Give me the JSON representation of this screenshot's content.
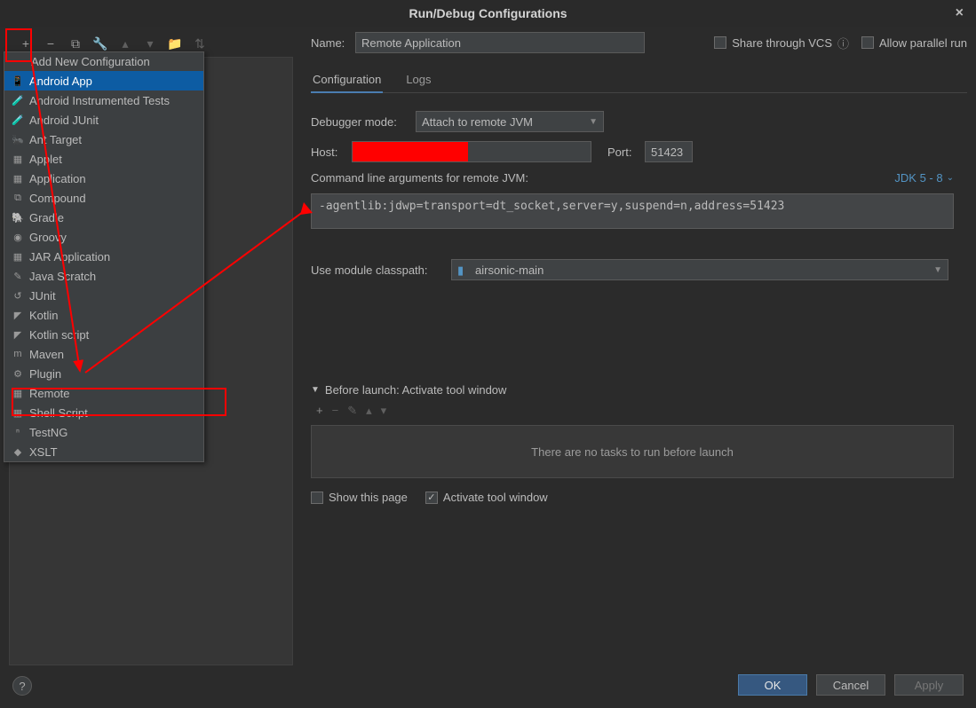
{
  "window": {
    "title": "Run/Debug Configurations"
  },
  "toolbar": {
    "add_hint": "+",
    "remove_hint": "−",
    "copy_hint": "⧉",
    "wrench_hint": "🔧",
    "up_hint": "▴",
    "down_hint": "▾",
    "folder_hint": "📁",
    "sort_hint": "⇅"
  },
  "dropdown": {
    "header": "Add New Configuration",
    "items": [
      {
        "label": "Android App",
        "icon": "📱",
        "selected": true
      },
      {
        "label": "Android Instrumented Tests",
        "icon": "🧪"
      },
      {
        "label": "Android JUnit",
        "icon": "🧪"
      },
      {
        "label": "Ant Target",
        "icon": "🐜"
      },
      {
        "label": "Applet",
        "icon": "▦"
      },
      {
        "label": "Application",
        "icon": "▦"
      },
      {
        "label": "Compound",
        "icon": "⧉"
      },
      {
        "label": "Gradle",
        "icon": "🐘"
      },
      {
        "label": "Groovy",
        "icon": "◉"
      },
      {
        "label": "JAR Application",
        "icon": "▦"
      },
      {
        "label": "Java Scratch",
        "icon": "✎"
      },
      {
        "label": "JUnit",
        "icon": "↺"
      },
      {
        "label": "Kotlin",
        "icon": "◤"
      },
      {
        "label": "Kotlin script",
        "icon": "◤"
      },
      {
        "label": "Maven",
        "icon": "m"
      },
      {
        "label": "Plugin",
        "icon": "⚙"
      },
      {
        "label": "Remote",
        "icon": "▦"
      },
      {
        "label": "Shell Script",
        "icon": "▦"
      },
      {
        "label": "TestNG",
        "icon": "ⁿ"
      },
      {
        "label": "XSLT",
        "icon": "◆"
      }
    ]
  },
  "form": {
    "name_label": "Name:",
    "name_value": "Remote Application",
    "share_vcs_label": "Share through VCS",
    "share_vcs_checked": false,
    "allow_parallel_label": "Allow parallel run",
    "allow_parallel_checked": false,
    "tabs": [
      {
        "label": "Configuration",
        "active": true
      },
      {
        "label": "Logs",
        "active": false
      }
    ],
    "debugger_mode_label": "Debugger mode:",
    "debugger_mode_value": "Attach to remote JVM",
    "host_label": "Host:",
    "port_label": "Port:",
    "port_value": "51423",
    "cmd_args_label": "Command line arguments for remote JVM:",
    "jdk_link": "JDK 5 - 8",
    "cmd_args_value": "-agentlib:jdwp=transport=dt_socket,server=y,suspend=n,address=51423",
    "module_classpath_label": "Use module classpath:",
    "module_classpath_value": "airsonic-main",
    "before_launch_header": "Before launch: Activate tool window",
    "no_tasks_text": "There are no tasks to run before launch",
    "show_this_page_label": "Show this page",
    "show_this_page_checked": false,
    "activate_tool_label": "Activate tool window",
    "activate_tool_checked": true
  },
  "buttons": {
    "ok": "OK",
    "cancel": "Cancel",
    "apply": "Apply",
    "help": "?"
  }
}
